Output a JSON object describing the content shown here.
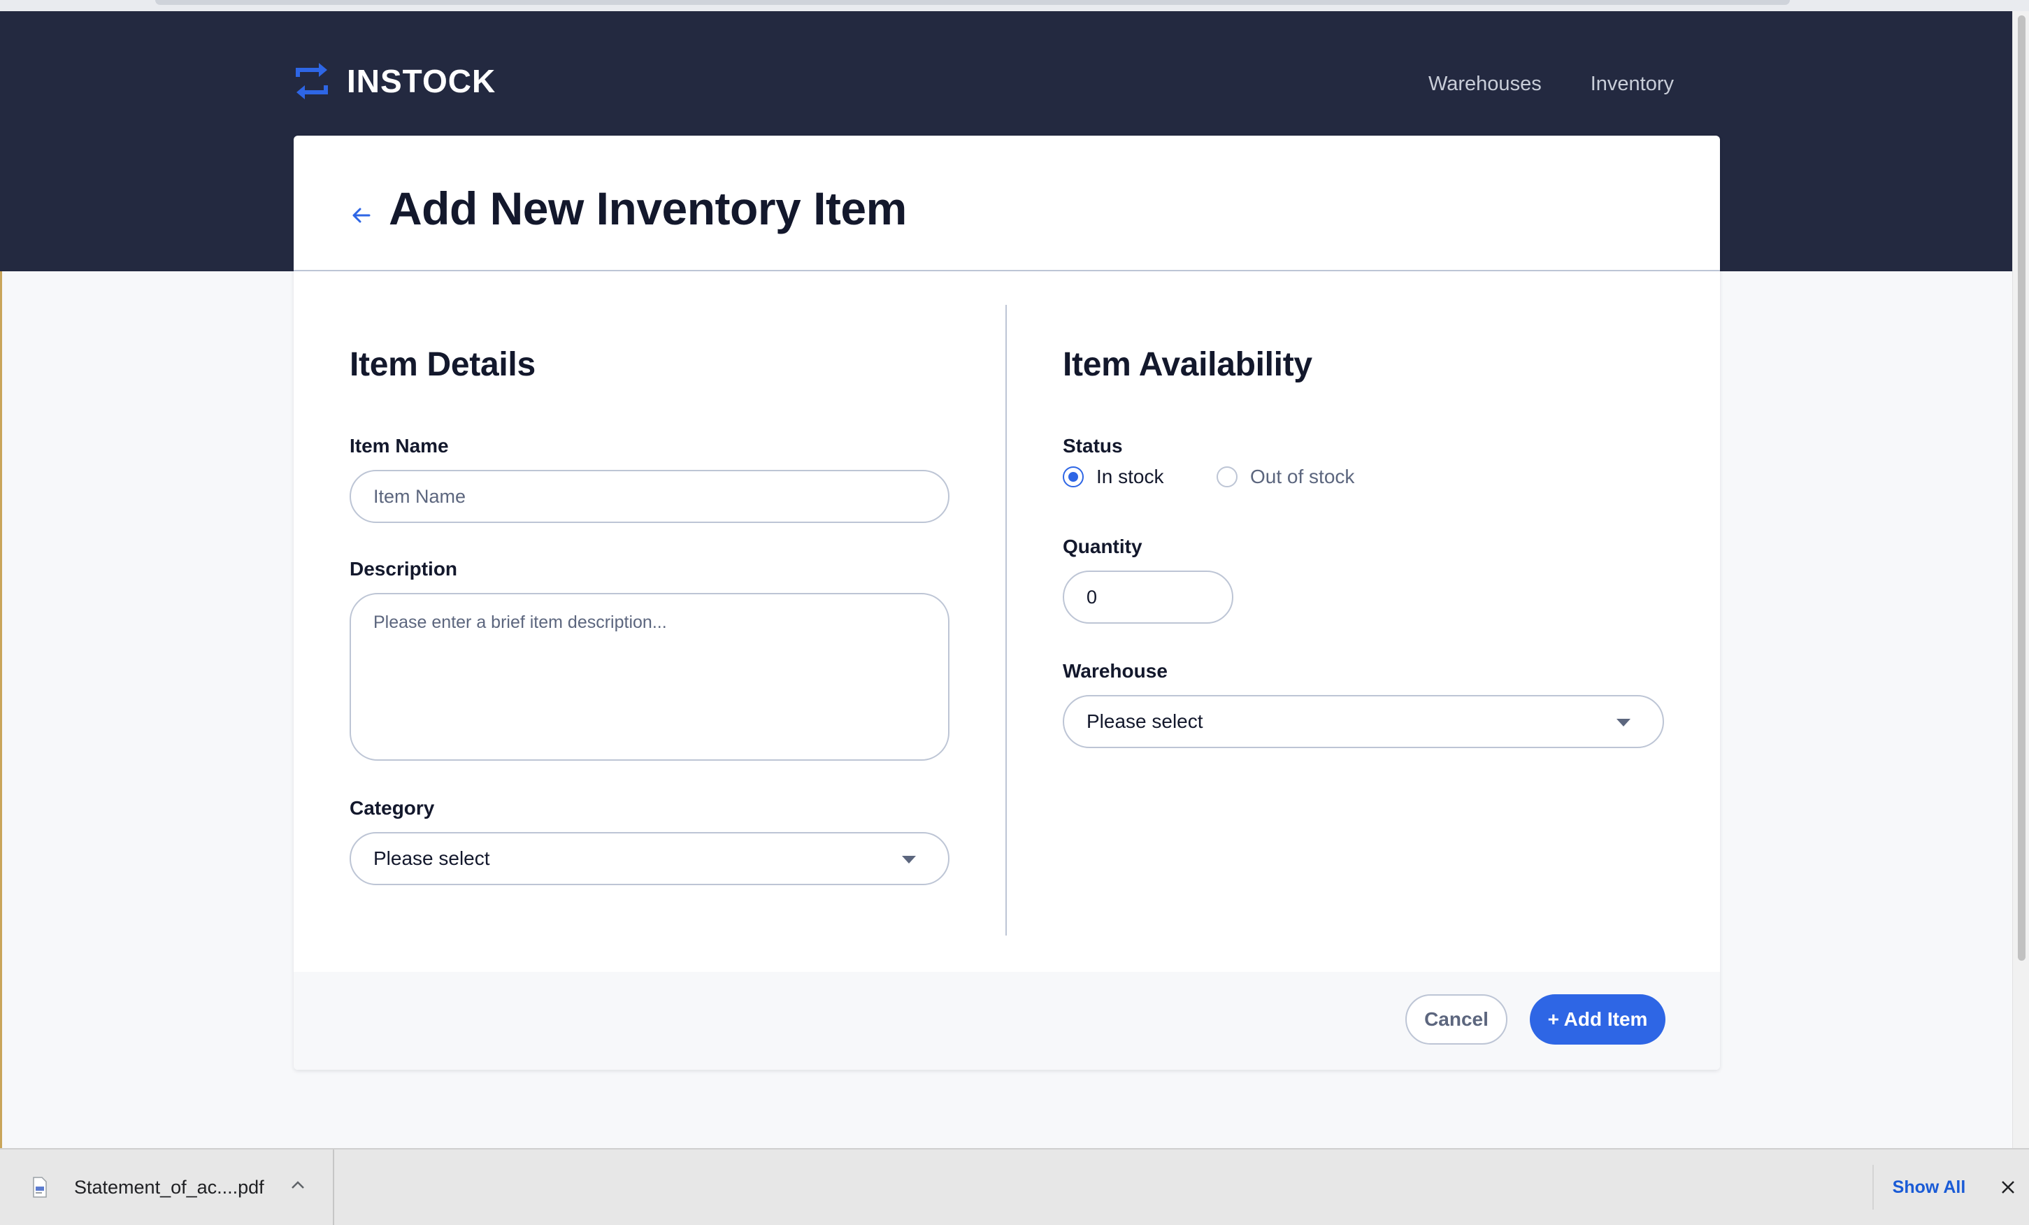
{
  "app": {
    "brand": "INSTOCK",
    "nav": {
      "warehouses": "Warehouses",
      "inventory": "Inventory"
    }
  },
  "page": {
    "title": "Add New Inventory Item"
  },
  "item_details": {
    "title": "Item Details",
    "item_name": {
      "label": "Item Name",
      "placeholder": "Item Name",
      "value": ""
    },
    "description": {
      "label": "Description",
      "placeholder": "Please enter a brief item description...",
      "value": ""
    },
    "category": {
      "label": "Category",
      "selected": "Please select"
    }
  },
  "item_availability": {
    "title": "Item Availability",
    "status": {
      "label": "Status",
      "options": [
        {
          "label": "In stock",
          "checked": true
        },
        {
          "label": "Out of stock",
          "checked": false
        }
      ]
    },
    "quantity": {
      "label": "Quantity",
      "value": "0"
    },
    "warehouse": {
      "label": "Warehouse",
      "selected": "Please select"
    }
  },
  "actions": {
    "cancel": "Cancel",
    "add": "+ Add Item"
  },
  "downloads": {
    "file_name": "Statement_of_ac....pdf",
    "show_all": "Show All"
  },
  "colors": {
    "header_bg": "#232940",
    "accent": "#2e66e5",
    "border": "#bdc5d5",
    "text": "#13182c",
    "muted": "#5c667e"
  }
}
